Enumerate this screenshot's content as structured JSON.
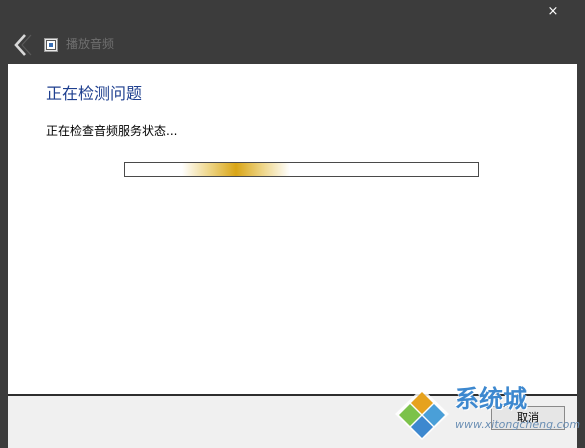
{
  "titlebar": {
    "app_title": "播放音频",
    "close_glyph": "×"
  },
  "main": {
    "heading": "正在检测问题",
    "status": "正在检查音频服务状态...",
    "progress": {
      "mode": "indeterminate",
      "color": "#d9a516"
    }
  },
  "footer": {
    "cancel_label": "取消"
  },
  "watermark": {
    "title": "系统城",
    "url": "www.xitongcheng.com"
  },
  "colors": {
    "frame": "#3c3c3c",
    "heading": "#1e3f8f",
    "accent": "#d9a516"
  },
  "icons": [
    "close-icon",
    "back-arrow-icon",
    "audio-troubleshooter-icon"
  ]
}
